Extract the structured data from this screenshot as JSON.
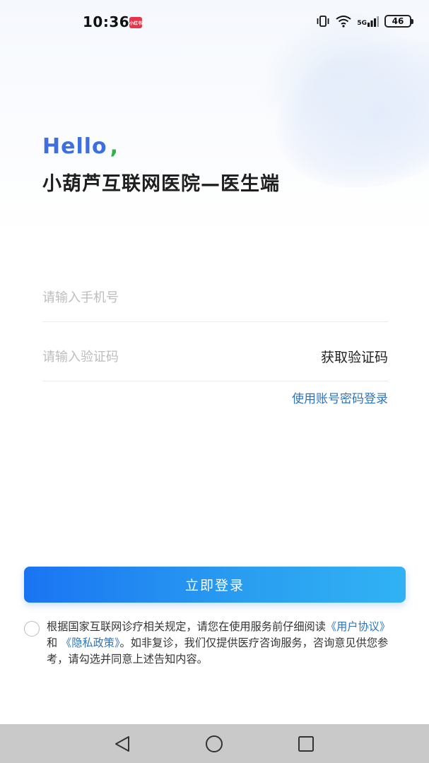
{
  "status_bar": {
    "time": "10:36",
    "app_badge": "小红书",
    "network": "5G",
    "battery": "46"
  },
  "greeting": {
    "hello": "Hello",
    "comma": ",",
    "title": "小葫芦互联网医院—医生端"
  },
  "form": {
    "phone_placeholder": "请输入手机号",
    "code_placeholder": "请输入验证码",
    "get_code_label": "获取验证码",
    "password_login_label": "使用账号密码登录",
    "login_button": "立即登录"
  },
  "agreement": {
    "text_prefix": "根据国家互联网诊疗相关规定，请您在使用服务前仔细阅读",
    "user_agreement": "《用户协议》",
    "and": " 和 ",
    "privacy_policy": "《隐私政策》",
    "text_suffix": "。如非复诊，我们仅提供医疗咨询服务，咨询意见供您参考，请勾选并同意上述告知内容。"
  },
  "colors": {
    "accent": "#1a74f2",
    "link": "#2f73b8",
    "hello": "#3d6fe0",
    "hello_comma": "#2ab34a"
  }
}
